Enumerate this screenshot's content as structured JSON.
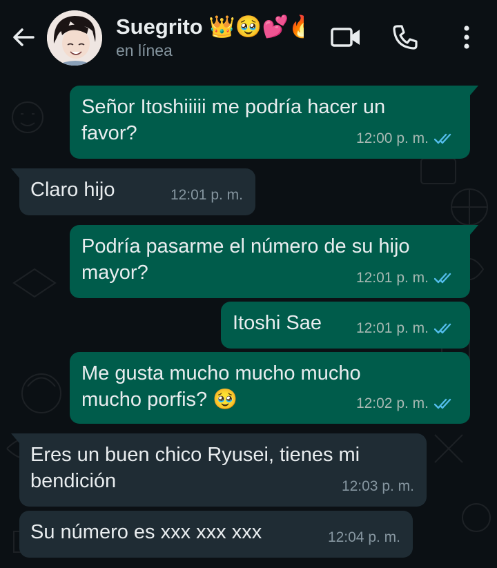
{
  "header": {
    "contact_name": "Suegrito 👑🥹💕🔥",
    "status": "en línea",
    "icons": [
      "back-arrow-icon",
      "video-call-icon",
      "phone-icon",
      "more-vert-icon"
    ]
  },
  "colors": {
    "background": "#0b1014",
    "outgoing_bubble": "#005c4b",
    "incoming_bubble": "#1f2c34",
    "read_ticks": "#53bdeb"
  },
  "messages": [
    {
      "direction": "out",
      "text": "Señor Itoshiiiii me podría hacer un\nfavor?",
      "time": "12:00 p. m.",
      "read": true
    },
    {
      "direction": "in",
      "text": "Claro hijo",
      "time": "12:01 p. m."
    },
    {
      "direction": "out",
      "text": "Podría pasarme el número de su hijo\nmayor?",
      "time": "12:01 p. m.",
      "read": true
    },
    {
      "direction": "out",
      "text": "Itoshi Sae",
      "time": "12:01 p. m.",
      "read": true
    },
    {
      "direction": "out",
      "text": "Me gusta mucho mucho mucho\nmucho porfis? 🥹",
      "time": "12:02 p. m.",
      "read": true
    },
    {
      "direction": "in",
      "text": "Eres un buen chico Ryusei, tienes mi\nbendición",
      "time": "12:03 p. m."
    },
    {
      "direction": "in",
      "text": "Su número es xxx xxx xxx",
      "time": "12:04 p. m."
    }
  ]
}
